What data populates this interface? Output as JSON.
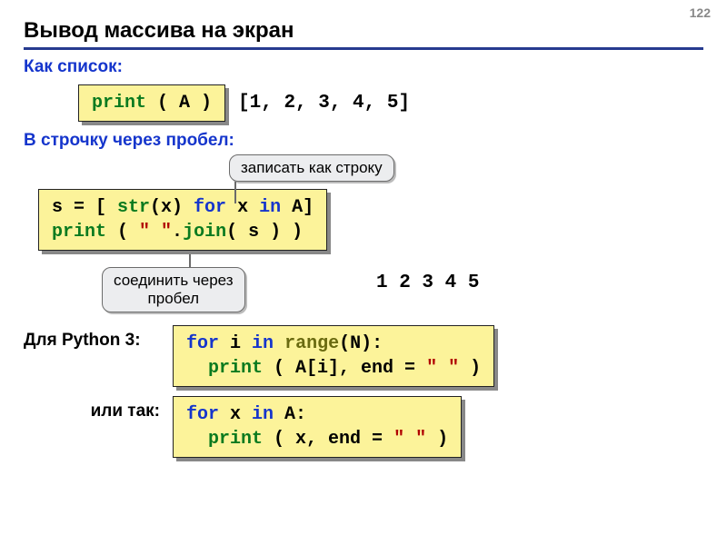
{
  "page_number": "122",
  "title": "Вывод массива на экран",
  "sec1": {
    "heading": "Как список:",
    "code_print": "print",
    "code_open": " ( A )",
    "output": "[1, 2, 3, 4, 5]"
  },
  "sec2": {
    "heading": "В строчку через пробел:",
    "callout_top": "записать как строку",
    "line1_pre": "s = [ ",
    "line1_str": "str",
    "line1_mid": "(x) ",
    "line1_for": "for",
    "line1_mid2": " x ",
    "line1_in": "in",
    "line1_end": " A]",
    "line2_print": "print",
    "line2_mid1": " ( ",
    "line2_lit1": "\" \"",
    "line2_dot": ".",
    "line2_join": "join",
    "line2_mid2": "( s ) )",
    "callout_bottom": "соединить через\nпробел",
    "output": "1 2 3 4 5"
  },
  "sec3": {
    "label": "Для Python 3:",
    "l1_for": "for",
    "l1_mid": " i ",
    "l1_in": "in",
    "l1_sp": " ",
    "l1_range": "range",
    "l1_tail": "(N):",
    "l2_indent": "  ",
    "l2_print": "print",
    "l2_mid": " ( A[i], end = ",
    "l2_lit": "\" \"",
    "l2_end": " )"
  },
  "sec4": {
    "label": "или так:",
    "l1_for": "for",
    "l1_mid": " x ",
    "l1_in": "in",
    "l1_tail": " A:",
    "l2_indent": "  ",
    "l2_print": "print",
    "l2_mid": " ( x, end = ",
    "l2_lit": "\" \"",
    "l2_end": " )"
  }
}
